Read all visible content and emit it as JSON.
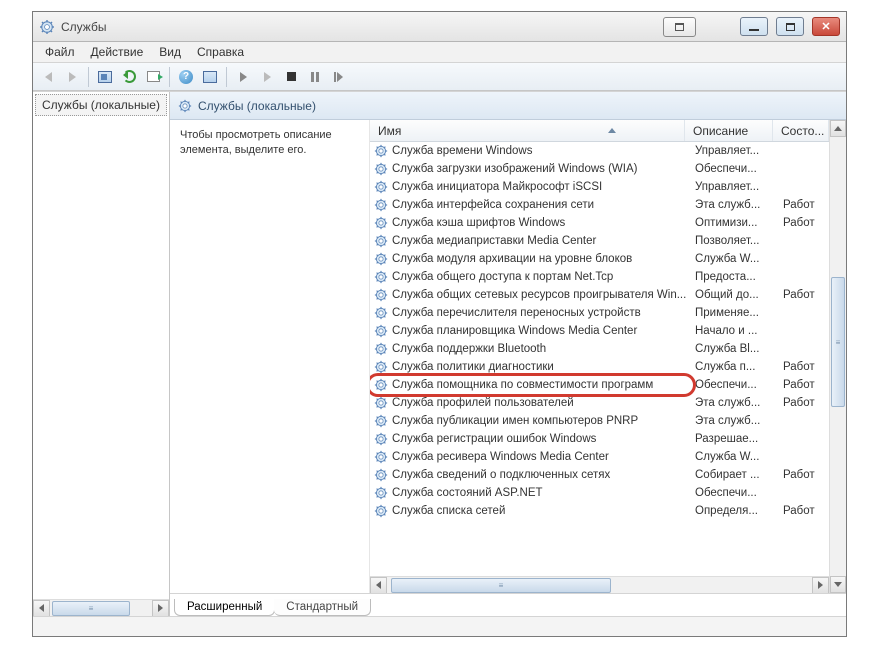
{
  "window": {
    "title": "Службы"
  },
  "menu": {
    "file": "Файл",
    "action": "Действие",
    "view": "Вид",
    "help": "Справка"
  },
  "left_tree": {
    "root": "Службы (локальные)"
  },
  "right": {
    "header": "Службы (локальные)",
    "description_hint": "Чтобы просмотреть описание элемента, выделите его.",
    "columns": {
      "name": "Имя",
      "description": "Описание",
      "state": "Состо..."
    },
    "tabs": {
      "extended": "Расширенный",
      "standard": "Стандартный"
    }
  },
  "services": [
    {
      "name": "Служба времени Windows",
      "desc": "Управляет...",
      "state": ""
    },
    {
      "name": "Служба загрузки изображений Windows (WIA)",
      "desc": "Обеспечи...",
      "state": ""
    },
    {
      "name": "Служба инициатора Майкрософт iSCSI",
      "desc": "Управляет...",
      "state": ""
    },
    {
      "name": "Служба интерфейса сохранения сети",
      "desc": "Эта служб...",
      "state": "Работ"
    },
    {
      "name": "Служба кэша шрифтов Windows",
      "desc": "Оптимизи...",
      "state": "Работ"
    },
    {
      "name": "Служба медиаприставки Media Center",
      "desc": "Позволяет...",
      "state": ""
    },
    {
      "name": "Служба модуля архивации на уровне блоков",
      "desc": "Служба W...",
      "state": ""
    },
    {
      "name": "Служба общего доступа к портам Net.Tcp",
      "desc": "Предоста...",
      "state": ""
    },
    {
      "name": "Служба общих сетевых ресурсов проигрывателя Win...",
      "desc": "Общий до...",
      "state": "Работ"
    },
    {
      "name": "Служба перечислителя переносных устройств",
      "desc": "Применяе...",
      "state": ""
    },
    {
      "name": "Служба планировщика Windows Media Center",
      "desc": "Начало и ...",
      "state": ""
    },
    {
      "name": "Служба поддержки Bluetooth",
      "desc": "Служба Bl...",
      "state": ""
    },
    {
      "name": "Служба политики диагностики",
      "desc": "Служба п...",
      "state": "Работ"
    },
    {
      "name": "Служба помощника по совместимости программ",
      "desc": "Обеспечи...",
      "state": "Работ"
    },
    {
      "name": "Служба профилей пользователей",
      "desc": "Эта служб...",
      "state": "Работ"
    },
    {
      "name": "Служба публикации имен компьютеров PNRP",
      "desc": "Эта служб...",
      "state": ""
    },
    {
      "name": "Служба регистрации ошибок Windows",
      "desc": "Разрешае...",
      "state": ""
    },
    {
      "name": "Служба ресивера Windows Media Center",
      "desc": "Служба W...",
      "state": ""
    },
    {
      "name": "Служба сведений о подключенных сетях",
      "desc": "Собирает ...",
      "state": "Работ"
    },
    {
      "name": "Служба состояний ASP.NET",
      "desc": "Обеспечи...",
      "state": ""
    },
    {
      "name": "Служба списка сетей",
      "desc": "Определя...",
      "state": "Работ"
    }
  ],
  "highlight_index": 13
}
